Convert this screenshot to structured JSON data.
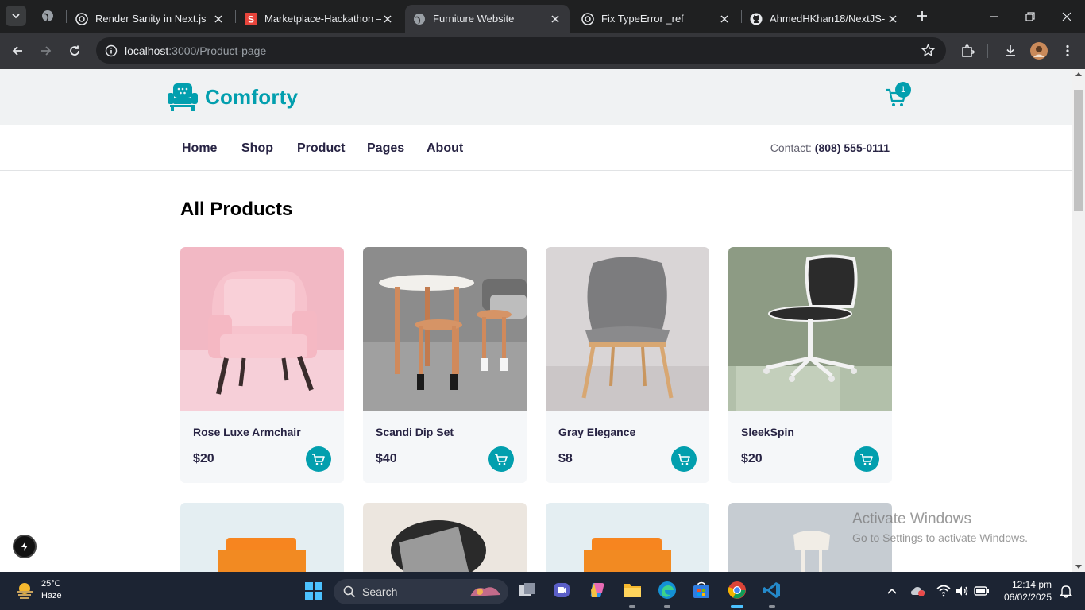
{
  "browser": {
    "tabs": [
      {
        "title": "Render Sanity in Next.js",
        "active": false
      },
      {
        "title": "Marketplace-Hackathon –",
        "active": false
      },
      {
        "title": "Furniture Website",
        "active": true
      },
      {
        "title": "Fix TypeError _ref",
        "active": false
      },
      {
        "title": "AhmedHKhan18/NextJS-D",
        "active": false
      }
    ],
    "url_host": "localhost",
    "url_path": ":3000/Product-page"
  },
  "site": {
    "brand": "Comforty",
    "cart_count": "1",
    "nav": [
      "Home",
      "Shop",
      "Product",
      "Pages",
      "About"
    ],
    "contact_label": "Contact:",
    "contact_phone": "(808) 555-0111",
    "section_title": "All Products",
    "products": [
      {
        "name": "Rose Luxe Armchair",
        "price": "$20"
      },
      {
        "name": "Scandi Dip Set",
        "price": "$40"
      },
      {
        "name": "Gray Elegance",
        "price": "$8"
      },
      {
        "name": "SleekSpin",
        "price": "$20"
      }
    ]
  },
  "watermark": {
    "line1": "Activate Windows",
    "line2": "Go to Settings to activate Windows."
  },
  "taskbar": {
    "temperature": "25°C",
    "condition": "Haze",
    "search_label": "Search",
    "time": "12:14 pm",
    "date": "06/02/2025"
  },
  "colors": {
    "accent": "#029fae",
    "heading": "#272343",
    "header_bg": "#f0f2f3"
  }
}
